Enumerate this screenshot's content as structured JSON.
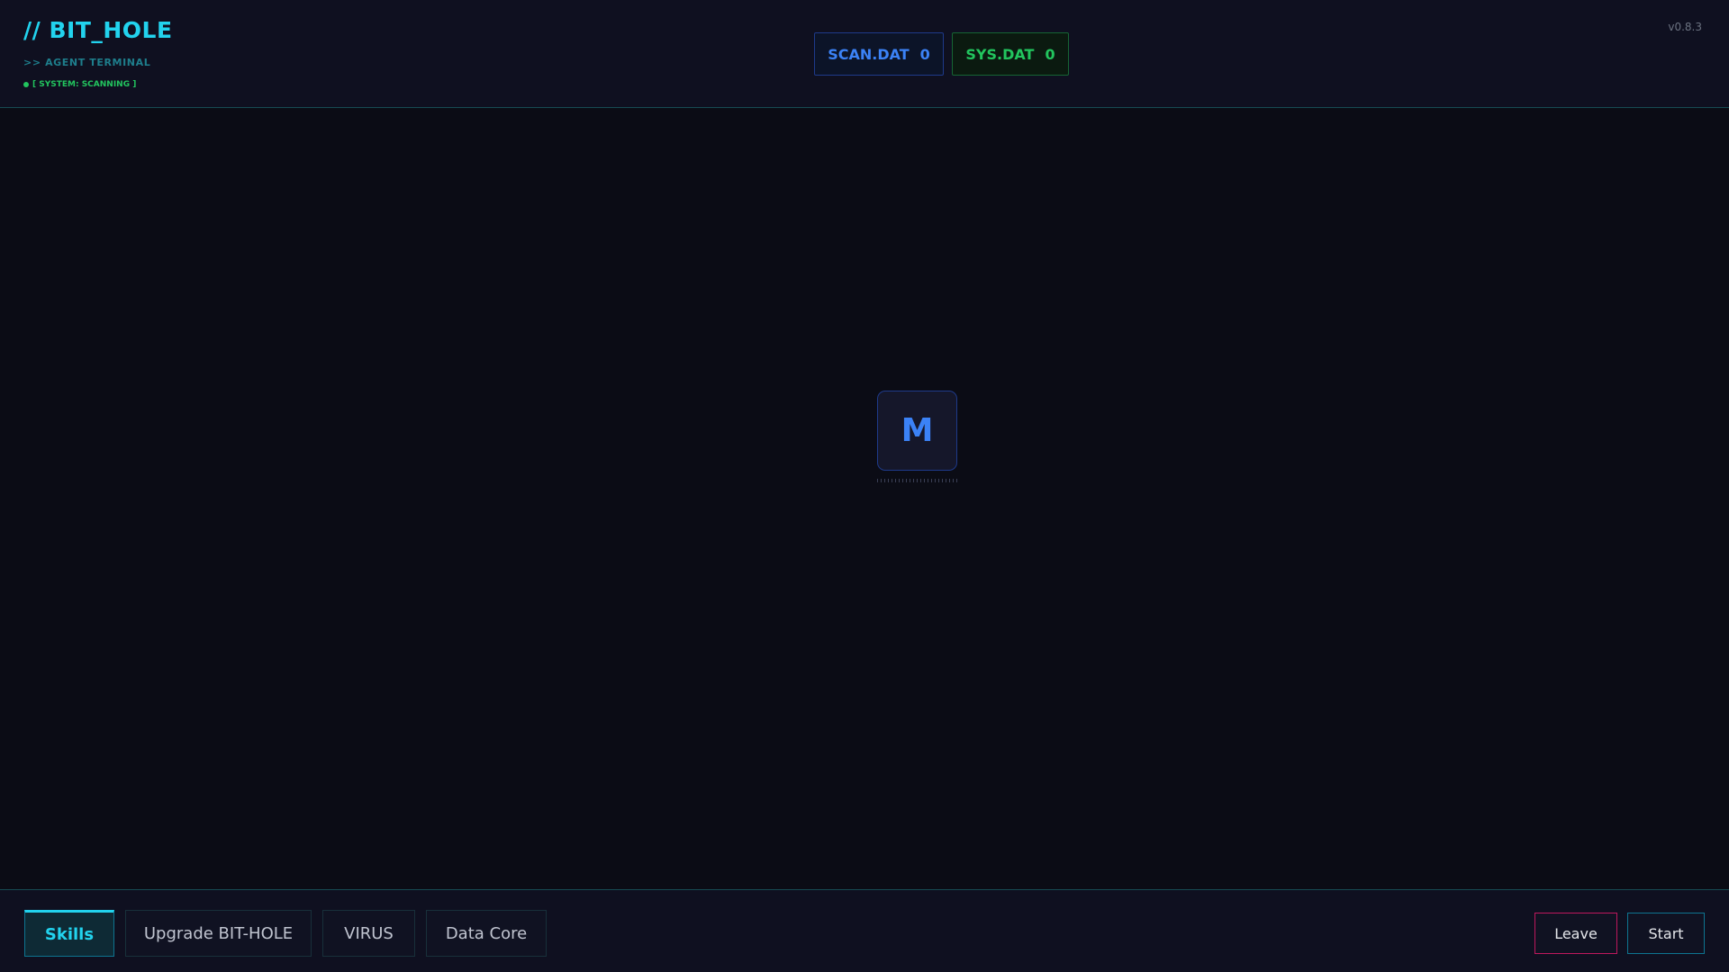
{
  "header": {
    "title": "// BIT_HOLE",
    "subtitle": ">> AGENT TERMINAL",
    "status": "[ SYSTEM: SCANNING ]",
    "version": "v0.8.3",
    "counters": [
      {
        "label": "SCAN.DAT",
        "value": "0"
      },
      {
        "label": "SYS.DAT",
        "value": "0"
      }
    ]
  },
  "main": {
    "center_tile": "M"
  },
  "footer": {
    "tabs": [
      {
        "label": "Skills"
      },
      {
        "label": "Upgrade BIT-HOLE"
      },
      {
        "label": "VIRUS"
      },
      {
        "label": "Data Core"
      }
    ],
    "active_tab": "Skills",
    "leave_label": "Leave",
    "start_label": "Start"
  },
  "colors": {
    "accent": "#22d3ee",
    "scan": "#3b82f6",
    "sys": "#22c55e",
    "leave_border": "#be185d"
  }
}
